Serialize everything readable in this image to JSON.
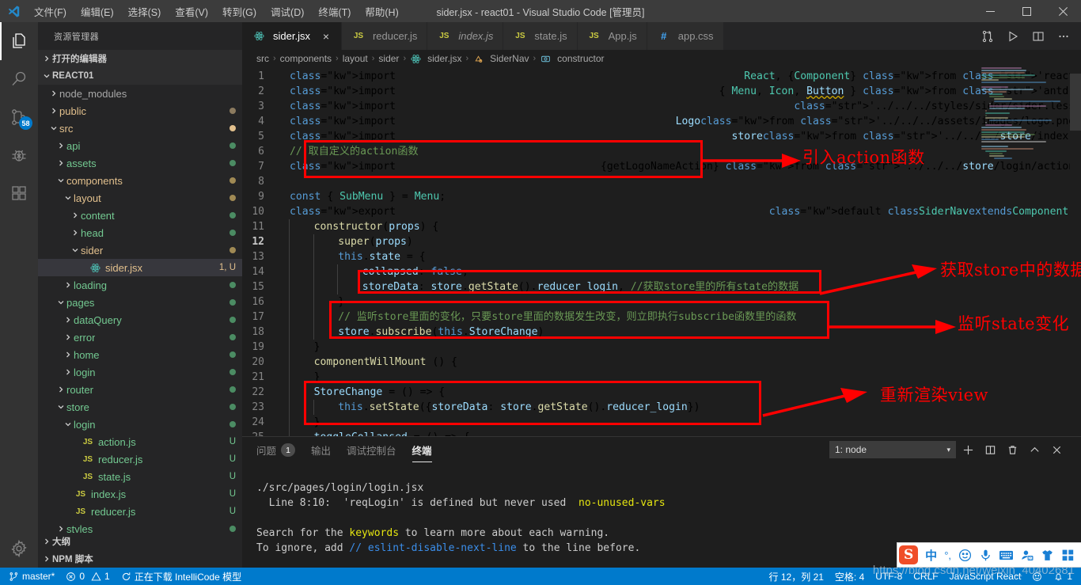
{
  "titlebar": {
    "menus": [
      "文件(F)",
      "编辑(E)",
      "选择(S)",
      "查看(V)",
      "转到(G)",
      "调试(D)",
      "终端(T)",
      "帮助(H)"
    ],
    "title": "sider.jsx - react01 - Visual Studio Code [管理员]",
    "logo_name": "vscode-logo"
  },
  "activitybar": {
    "items": [
      {
        "name": "explorer-icon",
        "badge": ""
      },
      {
        "name": "search-icon",
        "badge": ""
      },
      {
        "name": "source-control-icon",
        "badge": "58"
      },
      {
        "name": "debug-icon",
        "badge": ""
      },
      {
        "name": "extensions-icon",
        "badge": ""
      }
    ],
    "settings": {
      "name": "manage-gear-icon"
    }
  },
  "sidebar": {
    "title": "资源管理器",
    "open_editors": "打开的编辑器",
    "project": "REACT01",
    "tree": [
      {
        "label": "node_modules",
        "indent": 1,
        "type": "folder",
        "state": "collapsed",
        "color": "#a8a8a8",
        "dot": ""
      },
      {
        "label": "public",
        "indent": 1,
        "type": "folder",
        "state": "collapsed",
        "color": "#e2c08d",
        "dot": "#8c7b5f"
      },
      {
        "label": "src",
        "indent": 1,
        "type": "folder",
        "state": "expanded",
        "color": "#e2c08d",
        "dot": "#e2c08d"
      },
      {
        "label": "api",
        "indent": 2,
        "type": "folder",
        "state": "collapsed",
        "color": "#73c991",
        "dot": "#4b8c63"
      },
      {
        "label": "assets",
        "indent": 2,
        "type": "folder",
        "state": "collapsed",
        "color": "#73c991",
        "dot": "#4b8c63"
      },
      {
        "label": "components",
        "indent": 2,
        "type": "folder",
        "state": "expanded",
        "color": "#e2c08d",
        "dot": "#a08a54"
      },
      {
        "label": "layout",
        "indent": 3,
        "type": "folder",
        "state": "expanded",
        "color": "#e2c08d",
        "dot": "#a08a54"
      },
      {
        "label": "content",
        "indent": 4,
        "type": "folder",
        "state": "collapsed",
        "color": "#73c991",
        "dot": "#4b8c63"
      },
      {
        "label": "head",
        "indent": 4,
        "type": "folder",
        "state": "collapsed",
        "color": "#73c991",
        "dot": "#4b8c63"
      },
      {
        "label": "sider",
        "indent": 4,
        "type": "folder",
        "state": "expanded",
        "color": "#e2c08d",
        "dot": "#a08a54"
      },
      {
        "label": "sider.jsx",
        "indent": 5,
        "type": "react",
        "state": "file",
        "color": "#e2c08d",
        "badge": "1, U",
        "selected": true
      },
      {
        "label": "loading",
        "indent": 3,
        "type": "folder",
        "state": "collapsed",
        "color": "#73c991",
        "dot": "#4b8c63"
      },
      {
        "label": "pages",
        "indent": 2,
        "type": "folder",
        "state": "expanded",
        "color": "#73c991",
        "dot": "#4b8c63"
      },
      {
        "label": "dataQuery",
        "indent": 3,
        "type": "folder",
        "state": "collapsed",
        "color": "#73c991",
        "dot": "#4b8c63"
      },
      {
        "label": "error",
        "indent": 3,
        "type": "folder",
        "state": "collapsed",
        "color": "#73c991",
        "dot": "#4b8c63"
      },
      {
        "label": "home",
        "indent": 3,
        "type": "folder",
        "state": "collapsed",
        "color": "#73c991",
        "dot": "#4b8c63"
      },
      {
        "label": "login",
        "indent": 3,
        "type": "folder",
        "state": "collapsed",
        "color": "#73c991",
        "dot": "#4b8c63"
      },
      {
        "label": "router",
        "indent": 2,
        "type": "folder",
        "state": "collapsed",
        "color": "#73c991",
        "dot": "#4b8c63"
      },
      {
        "label": "store",
        "indent": 2,
        "type": "folder",
        "state": "expanded",
        "color": "#73c991",
        "dot": "#4b8c63"
      },
      {
        "label": "login",
        "indent": 3,
        "type": "folder",
        "state": "expanded",
        "color": "#73c991",
        "dot": "#4b8c63"
      },
      {
        "label": "action.js",
        "indent": 4,
        "type": "js",
        "state": "file",
        "color": "#73c991",
        "badge": "U"
      },
      {
        "label": "reducer.js",
        "indent": 4,
        "type": "js",
        "state": "file",
        "color": "#73c991",
        "badge": "U"
      },
      {
        "label": "state.js",
        "indent": 4,
        "type": "js",
        "state": "file",
        "color": "#73c991",
        "badge": "U"
      },
      {
        "label": "index.js",
        "indent": 3,
        "type": "js",
        "state": "file",
        "color": "#73c991",
        "badge": "U"
      },
      {
        "label": "reducer.js",
        "indent": 3,
        "type": "js",
        "state": "file",
        "color": "#73c991",
        "badge": "U"
      },
      {
        "label": "styles",
        "indent": 2,
        "type": "folder",
        "state": "collapsed",
        "color": "#73c991",
        "dot": "#4b8c63"
      }
    ],
    "outline": "大纲",
    "npm_scripts": "NPM 脚本"
  },
  "tabs": [
    {
      "label": "sider.jsx",
      "icon": "react-icon",
      "active": true,
      "italic": false,
      "close": "×"
    },
    {
      "label": "reducer.js",
      "icon": "js-icon",
      "active": false,
      "italic": false
    },
    {
      "label": "index.js",
      "icon": "js-icon",
      "active": false,
      "italic": true
    },
    {
      "label": "state.js",
      "icon": "js-icon",
      "active": false,
      "italic": false
    },
    {
      "label": "App.js",
      "icon": "js-icon",
      "active": false,
      "italic": false
    },
    {
      "label": "app.css",
      "icon": "css-icon",
      "active": false,
      "italic": false
    }
  ],
  "tab_actions": [
    "split-editor-diff-icon",
    "run-play-icon",
    "split-editor-icon",
    "more-actions-icon"
  ],
  "breadcrumbs": [
    "src",
    "components",
    "layout",
    "sider",
    "sider.jsx",
    "SiderNav",
    "constructor"
  ],
  "code": {
    "lines": [
      {
        "n": 1,
        "text": "import React, {Component} from 'react'"
      },
      {
        "n": 2,
        "text": "import { Menu, Icon, Button } from 'antd';"
      },
      {
        "n": 3,
        "text": "import '../../../styles/sider/sider.less'"
      },
      {
        "n": 4,
        "text": "import Logo from '../../../assets/images/logo.png'"
      },
      {
        "n": 5,
        "text": "import store from '../../../store/index';"
      },
      {
        "n": 6,
        "text": "// 取自定义的action函数"
      },
      {
        "n": 7,
        "text": "import {getLogoNameAction} from '../../../store/login/action'"
      },
      {
        "n": 8,
        "text": ""
      },
      {
        "n": 9,
        "text": "const { SubMenu } = Menu;"
      },
      {
        "n": 10,
        "text": "export default class SiderNav extends Component {"
      },
      {
        "n": 11,
        "text": "    constructor(props) {"
      },
      {
        "n": 12,
        "text": "        super(props)"
      },
      {
        "n": 13,
        "text": "        this.state = {"
      },
      {
        "n": 14,
        "text": "            collapsed: false,"
      },
      {
        "n": 15,
        "text": "            storeData: store.getState().reducer_login, //获取store里的所有state的数据"
      },
      {
        "n": 16,
        "text": "        }"
      },
      {
        "n": 17,
        "text": "        // 监听store里面的变化，只要store里面的数据发生改变，则立即执行subscribe函数里的函数"
      },
      {
        "n": 18,
        "text": "        store.subscribe(this.StoreChange)"
      },
      {
        "n": 19,
        "text": "    }"
      },
      {
        "n": 20,
        "text": "    componentWillMount () {"
      },
      {
        "n": 21,
        "text": "    }"
      },
      {
        "n": 22,
        "text": "    StoreChange = () => {"
      },
      {
        "n": 23,
        "text": "        this.setState({storeData: store.getState().reducer_login})"
      },
      {
        "n": 24,
        "text": "    }"
      },
      {
        "n": 25,
        "text": "    toggleCollansed = () => {"
      }
    ],
    "current_line": 12
  },
  "annotations": [
    {
      "name": "annotation-import-action",
      "text": "引入action函数"
    },
    {
      "name": "annotation-get-store-data",
      "text": "获取store中的数据"
    },
    {
      "name": "annotation-listen-state",
      "text": "监听state变化"
    },
    {
      "name": "annotation-rerender-view",
      "text": "重新渲染view"
    }
  ],
  "panel": {
    "tabs": [
      {
        "label": "问题",
        "badge": "1",
        "active": false
      },
      {
        "label": "输出",
        "badge": "",
        "active": false
      },
      {
        "label": "调试控制台",
        "badge": "",
        "active": false
      },
      {
        "label": "终端",
        "badge": "",
        "active": true
      }
    ],
    "terminal_select": "1: node",
    "actions": [
      "new-terminal-icon",
      "split-terminal-icon",
      "kill-terminal-icon",
      "maximize-panel-icon",
      "close-panel-icon"
    ],
    "output": {
      "l1": "./src/pages/login/login.jsx",
      "l2_a": "  Line 8:10:  'reqLogin' is defined but never used  ",
      "l2_b": "no-unused-vars",
      "l3": "",
      "l4_a": "Search for the ",
      "l4_b": "keywords",
      "l4_c": " to learn more about each warning.",
      "l5_a": "To ignore, add ",
      "l5_b": "// eslint-disable-next-line",
      "l5_c": " to the line before."
    }
  },
  "statusbar": {
    "branch": "master*",
    "errors": "0",
    "warnings": "1",
    "task": "正在下载 IntelliCode 模型",
    "position": "行 12，列 21",
    "indent": "空格: 4",
    "encoding": "UTF-8",
    "eol": "CRLF",
    "language": "JavaScript React",
    "bell": "1"
  },
  "watermark": "https://blog.csdn.net/weixin_40402681",
  "ime": {
    "logo": "S",
    "mode": "中",
    "punct": "°,",
    "items": [
      "sogou-logo",
      "chinese-mode",
      "punctuation-icon",
      "emoji-icon",
      "voice-input-icon",
      "soft-keyboard-icon",
      "user-icon",
      "skin-icon",
      "toolbox-icon"
    ]
  },
  "colors": {
    "accent": "#007acc",
    "annotation": "#ff0000",
    "editor_bg": "#1e1e1e",
    "sidebar_bg": "#252526"
  }
}
